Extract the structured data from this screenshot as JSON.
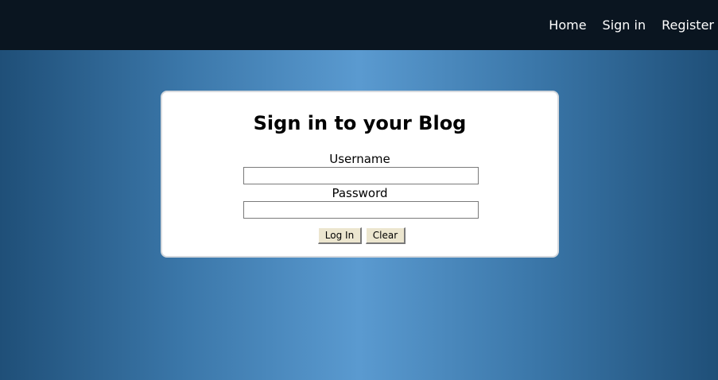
{
  "nav": {
    "items": [
      "Home",
      "Sign in",
      "Register"
    ]
  },
  "card": {
    "title": "Sign in to your Blog",
    "username_label": "Username",
    "username_value": "",
    "password_label": "Password",
    "password_value": "",
    "login_label": "Log In",
    "clear_label": "Clear"
  },
  "colors": {
    "topbar": "#0a1520",
    "gradient_center": "#5a9ad0",
    "gradient_edge": "#1f4f78",
    "card_background": "#ffffff",
    "button_background": "#ece6cf"
  }
}
